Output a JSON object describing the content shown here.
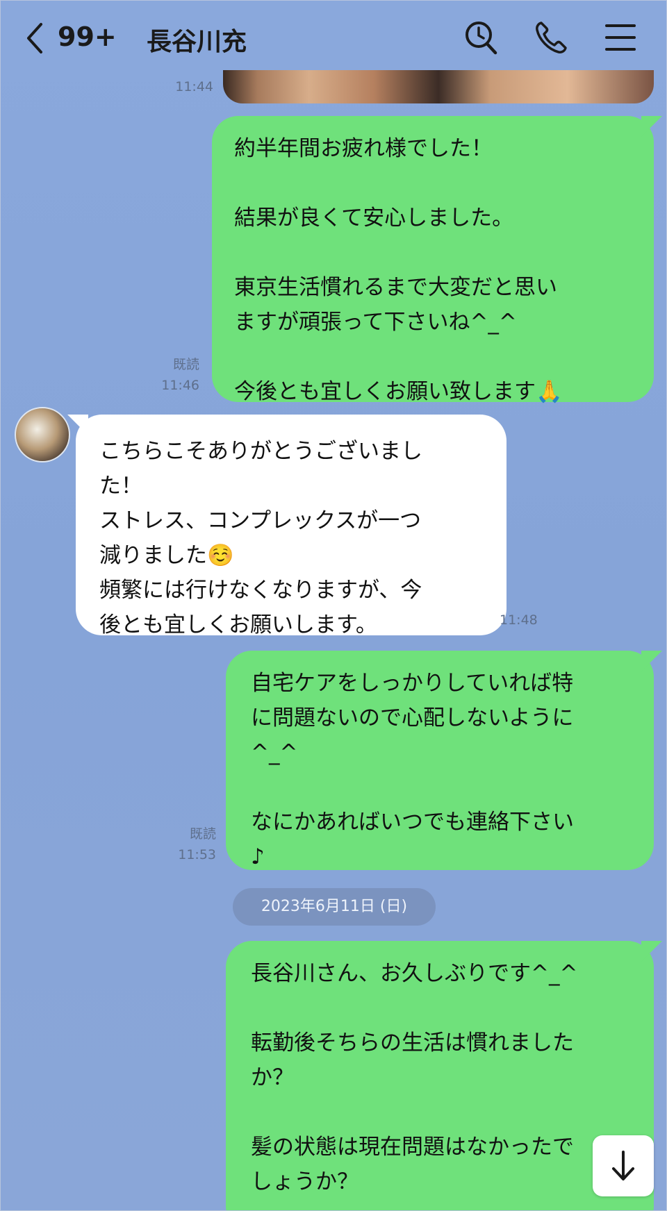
{
  "header": {
    "unread_count": "99+",
    "contact_name": "長谷川充"
  },
  "messages": [
    {
      "time": "11:44"
    },
    {
      "read": "既読",
      "time": "11:46",
      "text": "約半年間お疲れ様でした！\n\n結果が良くて安心しました。\n\n東京生活慣れるまで大変だと思い\nますが頑張って下さいね^_^\n\n今後とも宜しくお願い致します🙏"
    },
    {
      "time": "11:48",
      "text": "こちらこそありがとうございまし\nた！\nストレス、コンプレックスが一つ\n減りました☺️\n頻繁には行けなくなりますが、今\n後とも宜しくお願いします。"
    },
    {
      "read": "既読",
      "time": "11:53",
      "text": "自宅ケアをしっかりしていれば特\nに問題ないので心配しないように\n^_^\n\nなにかあればいつでも連絡下さい\n♪"
    },
    {
      "text": "長谷川さん、お久しぶりです^_^\n\n転勤後そちらの生活は慣れました\nか？\n\n髪の状態は現在問題はなかったで\nしょうか？"
    }
  ],
  "date_separator": "2023年6月11日 (日)",
  "icons": {
    "back": "chevron-left-icon",
    "search": "search-icon",
    "call": "phone-icon",
    "menu": "menu-icon",
    "scroll_down": "arrow-down-icon"
  },
  "colors": {
    "background": "#87a6da",
    "outgoing_bubble": "#6fe17b",
    "incoming_bubble": "#ffffff"
  }
}
